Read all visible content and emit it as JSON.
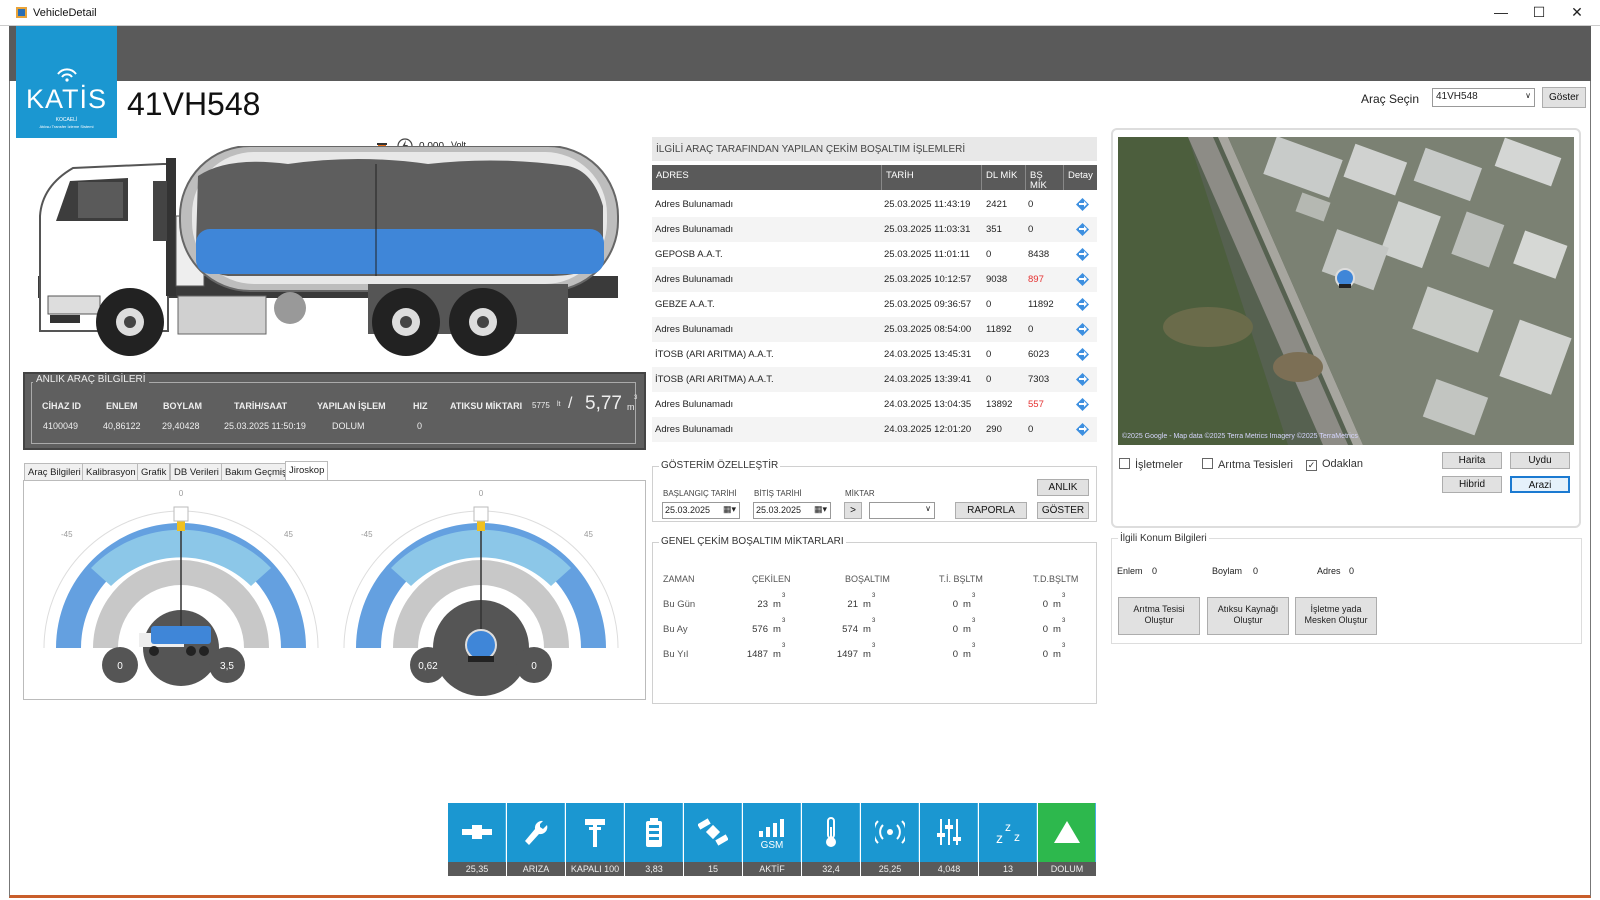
{
  "window": {
    "title": "VehicleDetail"
  },
  "logo": {
    "name": "KATİS",
    "line1": "KOCAELİ",
    "line2": "Atıksu Transfer İzleme Sistemi"
  },
  "vehicle": {
    "plate": "41VH548"
  },
  "selector": {
    "label": "Araç Seçin",
    "value": "41VH548",
    "button": "Göster"
  },
  "volt": {
    "value": "0.000",
    "unit": "Volt"
  },
  "tank": {
    "fill_fraction": 0.25
  },
  "anlik": {
    "legend": "ANLIK ARAÇ BİLGİLERİ",
    "headers": [
      "CİHAZ ID",
      "ENLEM",
      "BOYLAM",
      "TARİH/SAAT",
      "YAPILAN İŞLEM",
      "HIZ",
      "ATIKSU MİKTARI"
    ],
    "values": [
      "4100049",
      "40,86122",
      "29,40428",
      "25.03.2025 11:50:19",
      "DOLUM",
      "0"
    ],
    "litre": "5775",
    "litre_unit": "lt",
    "slash": "/",
    "m3": "5,77",
    "m3_unit": "m",
    "m3_sup": "3"
  },
  "tabs": [
    "Araç Bilgileri",
    "Kalibrasyon",
    "Grafik",
    "DB Verileri",
    "Bakım Geçmişi",
    "Jiroskop"
  ],
  "active_tab": "Jiroskop",
  "gyro": {
    "left": {
      "tick_top": "0",
      "tick_left": "-45",
      "tick_right": "45",
      "v1": "0",
      "v2": "3,5"
    },
    "right": {
      "tick_top": "0",
      "tick_left": "-45",
      "tick_right": "45",
      "v1": "0,62",
      "v2": "0"
    }
  },
  "list": {
    "title": "İLGİLİ ARAÇ TARAFINDAN YAPILAN ÇEKİM BOŞALTIM İŞLEMLERİ",
    "headers": [
      "ADRES",
      "TARİH",
      "DL MİK",
      "BŞ MİK",
      "Detay"
    ],
    "rows": [
      {
        "adres": "Adres Bulunamadı",
        "tarih": "25.03.2025 11:43:19",
        "dl": "2421",
        "bs": "0",
        "bs_red": false
      },
      {
        "adres": "Adres Bulunamadı",
        "tarih": "25.03.2025 11:03:31",
        "dl": "351",
        "bs": "0",
        "bs_red": false
      },
      {
        "adres": "GEPOSB A.A.T.",
        "tarih": "25.03.2025 11:01:11",
        "dl": "0",
        "bs": "8438",
        "bs_red": false
      },
      {
        "adres": "Adres Bulunamadı",
        "tarih": "25.03.2025 10:12:57",
        "dl": "9038",
        "bs": "897",
        "bs_red": true
      },
      {
        "adres": "GEBZE A.A.T.",
        "tarih": "25.03.2025 09:36:57",
        "dl": "0",
        "bs": "11892",
        "bs_red": false
      },
      {
        "adres": "Adres Bulunamadı",
        "tarih": "25.03.2025 08:54:00",
        "dl": "11892",
        "bs": "0",
        "bs_red": false
      },
      {
        "adres": "İTOSB (ARI ARITMA) A.A.T.",
        "tarih": "24.03.2025 13:45:31",
        "dl": "0",
        "bs": "6023",
        "bs_red": false
      },
      {
        "adres": "İTOSB (ARI ARITMA) A.A.T.",
        "tarih": "24.03.2025 13:39:41",
        "dl": "0",
        "bs": "7303",
        "bs_red": false
      },
      {
        "adres": "Adres Bulunamadı",
        "tarih": "24.03.2025 13:04:35",
        "dl": "13892",
        "bs": "557",
        "bs_red": true
      },
      {
        "adres": "Adres Bulunamadı",
        "tarih": "24.03.2025 12:01:20",
        "dl": "290",
        "bs": "0",
        "bs_red": false
      }
    ]
  },
  "gosterim": {
    "legend": "GÖSTERİM ÖZELLEŞTİR",
    "start_label": "BAŞLANGIÇ TARİHİ",
    "start_value": "25.03.2025",
    "end_label": "BİTİŞ TARİHİ",
    "end_value": "25.03.2025",
    "miktar_label": "MİKTAR",
    "op": ">",
    "miktar_value": "",
    "anlik_btn": "ANLIK",
    "raporla_btn": "RAPORLA",
    "goster_btn": "GÖSTER"
  },
  "genel": {
    "legend": "GENEL ÇEKİM BOŞALTIM MİKTARLARI",
    "headers": [
      "ZAMAN",
      "ÇEKİLEN",
      "BOŞALTIM",
      "T.İ. BŞLTM",
      "T.D.BŞLTM"
    ],
    "unit": "m",
    "sup": "3",
    "rows": [
      {
        "zaman": "Bu Gün",
        "cekilen": "23",
        "bosaltim": "21",
        "ti": "0",
        "td": "0"
      },
      {
        "zaman": "Bu Ay",
        "cekilen": "576",
        "bosaltim": "574",
        "ti": "0",
        "td": "0"
      },
      {
        "zaman": "Bu Yıl",
        "cekilen": "1487",
        "bosaltim": "1497",
        "ti": "0",
        "td": "0"
      }
    ]
  },
  "map": {
    "attribution": "©2025 Google - Map data ©2025 Terra Metrics Imagery ©2025 TerraMetrics",
    "checks": [
      {
        "label": "İşletmeler",
        "checked": false
      },
      {
        "label": "Arıtma Tesisleri",
        "checked": false
      },
      {
        "label": "Odaklan",
        "checked": true
      }
    ],
    "buttons": [
      "Harita",
      "Uydu",
      "Hibrid",
      "Arazi"
    ],
    "active_button": "Arazi"
  },
  "konum": {
    "legend": "İlgili Konum Bilgileri",
    "enlem_label": "Enlem",
    "enlem_value": "0",
    "boylam_label": "Boylam",
    "boylam_value": "0",
    "adres_label": "Adres",
    "adres_value": "0",
    "btn1": "Arıtma Tesisi Oluştur",
    "btn2": "Atıksu Kaynağı Oluştur",
    "btn3": "İşletme yada Mesken Oluştur"
  },
  "status_bar": [
    {
      "icon": "pipe-icon",
      "label": "25,35",
      "active": false
    },
    {
      "icon": "wrench-icon",
      "label": "ARIZA",
      "active": false
    },
    {
      "icon": "valve-icon",
      "label": "KAPALI 100",
      "active": false
    },
    {
      "icon": "battery-icon",
      "label": "3,83",
      "active": false
    },
    {
      "icon": "satellite-icon",
      "label": "15",
      "active": false
    },
    {
      "icon": "gsm-icon",
      "label": "AKTİF",
      "gsm_text": "GSM",
      "active": false
    },
    {
      "icon": "thermometer-icon",
      "label": "32,4",
      "active": false
    },
    {
      "icon": "signal-icon",
      "label": "25,25",
      "active": false
    },
    {
      "icon": "sliders-icon",
      "label": "4,048",
      "active": false
    },
    {
      "icon": "sleep-icon",
      "label": "13",
      "active": false
    },
    {
      "icon": "up-arrow-icon",
      "label": "DOLUM",
      "active": true
    }
  ],
  "colors": {
    "accent": "#1b97d1",
    "header": "#5a5a5a",
    "active_green": "#2db84d",
    "red": "#e53030"
  }
}
